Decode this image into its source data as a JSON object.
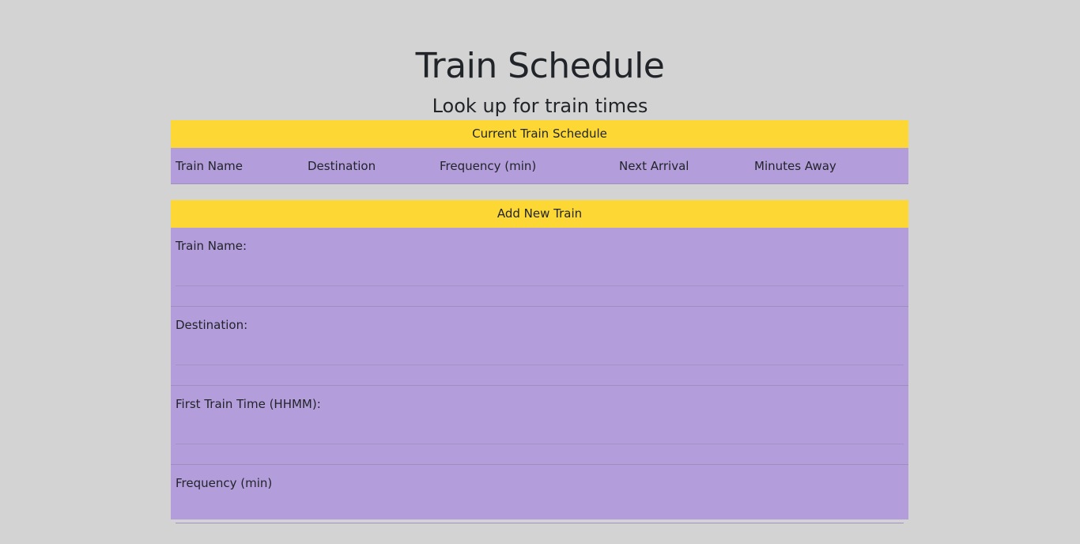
{
  "header": {
    "title": "Train Schedule",
    "subtitle": "Look up for train times"
  },
  "schedule": {
    "heading": "Current Train Schedule",
    "columns": [
      "Train Name",
      "Destination",
      "Frequency (min)",
      "Next Arrival",
      "Minutes Away"
    ]
  },
  "add_train": {
    "heading": "Add New Train",
    "fields": [
      {
        "label": "Train Name:",
        "value": ""
      },
      {
        "label": "Destination:",
        "value": ""
      },
      {
        "label": "First Train Time (HHMM):",
        "value": ""
      },
      {
        "label": "Frequency (min)",
        "value": ""
      }
    ]
  },
  "colors": {
    "background": "#d3d3d3",
    "panel_heading": "#fdd835",
    "panel_body": "#b39ddb"
  }
}
